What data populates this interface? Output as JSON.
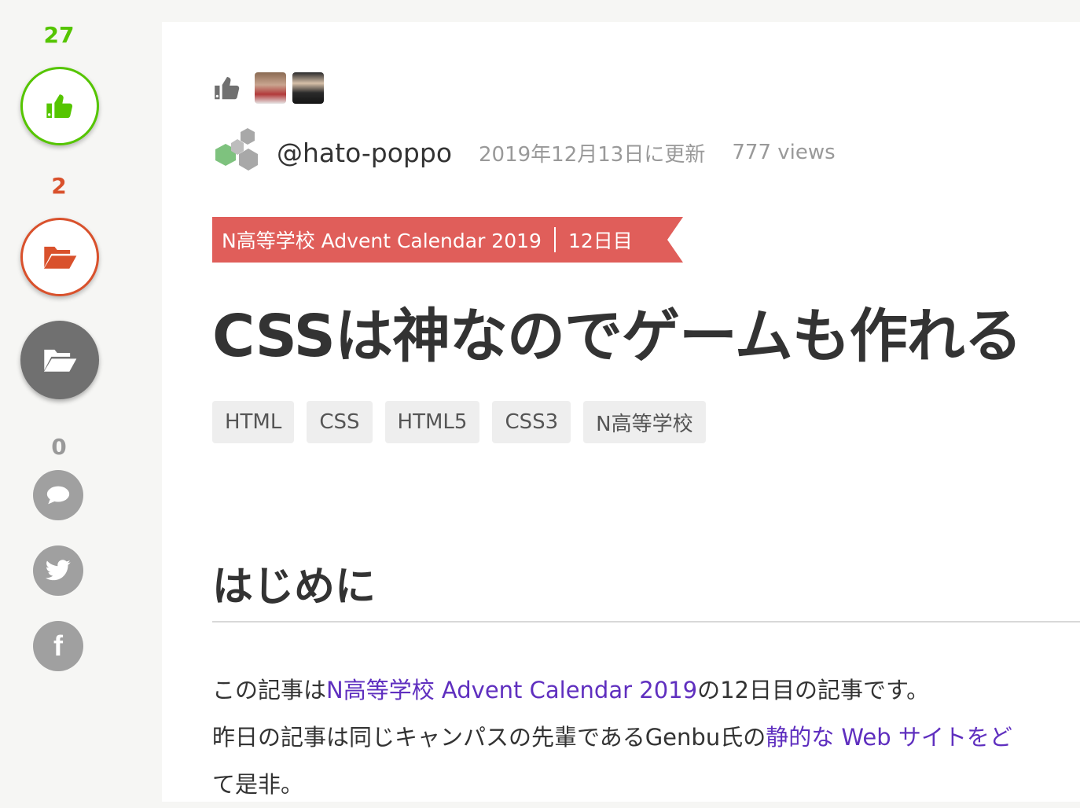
{
  "colors": {
    "like_green": "#55c500",
    "stock_red": "#d9512c",
    "banner_red": "#e05e5a",
    "link_purple": "#5f2fbf"
  },
  "sidebar": {
    "like_count": "27",
    "stock_count": "2",
    "comment_count": "0",
    "icons": [
      "thumbs-up-icon",
      "folder-open-icon",
      "folder-open-icon",
      "comment-icon",
      "twitter-icon",
      "facebook-icon"
    ],
    "facebook_glyph": "f"
  },
  "article": {
    "author": "@hato-poppo",
    "updated": "2019年12月13日に更新",
    "views": "777 views",
    "advent": {
      "calendar": "N高等学校 Advent Calendar 2019",
      "day": "12日目"
    },
    "title": "CSSは神なのでゲームも作れる",
    "tags": [
      "HTML",
      "CSS",
      "HTML5",
      "CSS3",
      "N高等学校"
    ],
    "section_heading": "はじめに",
    "paragraph1": {
      "pre": "この記事は",
      "link": "N高等学校 Advent Calendar 2019",
      "post": "の12日目の記事です。"
    },
    "paragraph2": {
      "pre": "昨日の記事は同じキャンパスの先輩であるGenbu氏の",
      "link": "静的な Web サイトをど"
    },
    "paragraph3": "て是非。"
  }
}
